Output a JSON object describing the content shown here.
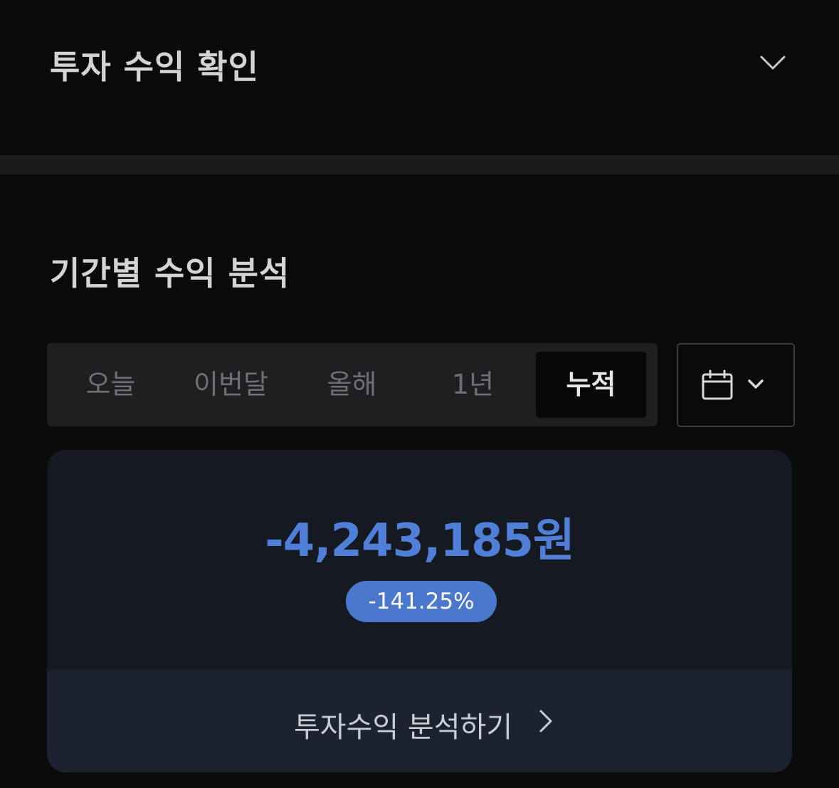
{
  "header": {
    "title": "투자 수익 확인",
    "toggle_icon": "chevron-down-icon"
  },
  "period_section": {
    "title": "기간별 수익 분석",
    "tabs": [
      {
        "label": "오늘",
        "active": false
      },
      {
        "label": "이번달",
        "active": false
      },
      {
        "label": "올해",
        "active": false
      },
      {
        "label": "1년",
        "active": false
      },
      {
        "label": "누적",
        "active": true
      }
    ],
    "calendar_icon": "calendar-icon",
    "calendar_dropdown_icon": "chevron-down-icon"
  },
  "summary_card": {
    "amount": "-4,243,185원",
    "rate": "-141.25%",
    "action_label": "투자수익 분석하기",
    "action_icon": "chevron-right-icon"
  },
  "colors": {
    "background": "#0a0a0b",
    "loss_blue": "#4f7fd6",
    "badge_blue": "#4b78cc",
    "card_bg": "#141922",
    "card_footer_bg": "#1c2230"
  }
}
